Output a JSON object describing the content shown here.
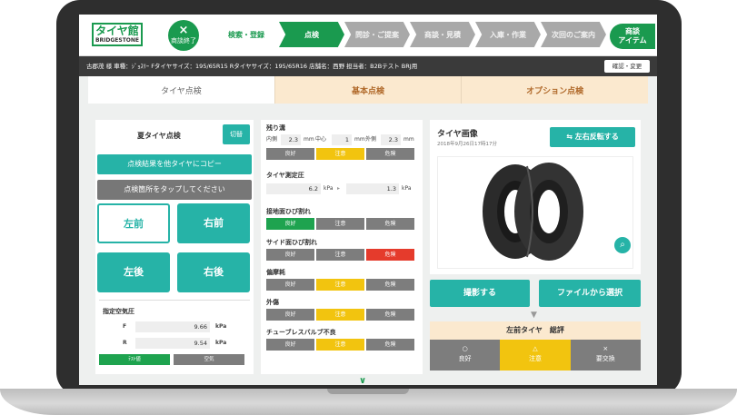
{
  "header": {
    "logo_text": "タイヤ館",
    "logo_sub": "BRIDGESTONE",
    "end_icon": "×",
    "end_label": "商談終了",
    "steps": [
      {
        "label": "検索・登録",
        "state": "done"
      },
      {
        "label": "点検",
        "state": "active"
      },
      {
        "label": "問診・ご提案",
        "state": "future"
      },
      {
        "label": "商談・見積",
        "state": "future"
      },
      {
        "label": "入庫・作業",
        "state": "future"
      },
      {
        "label": "次回のご案内",
        "state": "future"
      }
    ],
    "item_btn": "商談\nアイテム"
  },
  "infobar": {
    "text": "古郡茂 様  車種：ｼﾞｮｽﾘｰ   Fタイヤサイズ：195/65R15   Rタイヤサイズ：195/65R16   店舗名：西野   担当者：B2Bテスト BRJ用",
    "button": "確認・変更"
  },
  "tabs": [
    "タイヤ点検",
    "基本点検",
    "オプション点検"
  ],
  "left": {
    "title": "夏タイヤ点検",
    "switch": "切替",
    "copy_btn": "点検結果を他タイヤにコピー",
    "hint": "点検箇所をタップしてください",
    "positions": [
      "左前",
      "右前",
      "左後",
      "右後"
    ],
    "pressure_title": "指定空気圧",
    "f_label": "F",
    "f_value": "9.66",
    "r_label": "R",
    "r_value": "9.54",
    "unit": "kPa",
    "btn_a": "ﾃｽﾄ値",
    "btn_b": "空気"
  },
  "middle": {
    "groove_title": "残り溝",
    "inner_label": "内側",
    "inner_value": "2.3",
    "center_label": "中心",
    "center_value": "1",
    "outer_label": "外側",
    "outer_value": "2.3",
    "mm": "mm",
    "measure_title": "タイヤ測定圧",
    "measure_before": "6.2",
    "measure_after": "1.3",
    "kpa": "kPa",
    "rating_labels": [
      "良好",
      "注意",
      "危険"
    ],
    "rows": [
      {
        "title": "接地面ひび割れ",
        "selected": 0
      },
      {
        "title": "サイド面ひび割れ",
        "selected": 2
      },
      {
        "title": "偏摩耗",
        "selected": 1
      },
      {
        "title": "外傷",
        "selected": 1
      },
      {
        "title": "チューブレスバルブ不良",
        "selected": 1
      }
    ],
    "groove_selected": 1
  },
  "right": {
    "title": "タイヤ画像",
    "date": "2018年9月26日17時17分",
    "flip_btn": "左右反転する",
    "shoot_btn": "撮影する",
    "file_btn": "ファイルから選択",
    "summary_title": "左前タイヤ　総評",
    "eval": [
      {
        "icon": "○",
        "label": "良好"
      },
      {
        "icon": "△",
        "label": "注意"
      },
      {
        "icon": "×",
        "label": "要交換"
      }
    ]
  },
  "colors": {
    "brand": "#1a9a4f",
    "teal": "#26b3a7",
    "warn": "#f2c40f",
    "danger": "#e53b2c"
  }
}
